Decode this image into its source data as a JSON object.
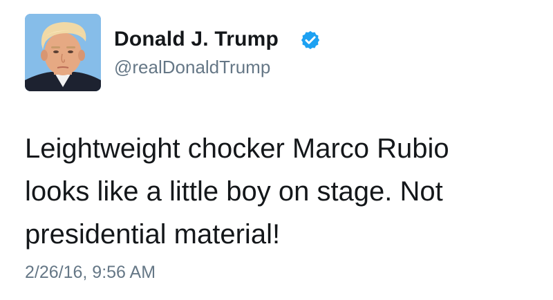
{
  "author": {
    "display_name": "Donald J. Trump",
    "handle": "@realDonaldTrump",
    "verified": true,
    "verified_color": "#1da1f2"
  },
  "tweet": {
    "lines": [
      "Leightweight chocker Marco Rubio",
      "looks like a little boy on stage. Not",
      "presidential material!"
    ],
    "timestamp": "2/26/16, 9:56 AM"
  },
  "icons": {
    "verified": "verified-check-badge-icon",
    "avatar": "profile-photo"
  }
}
